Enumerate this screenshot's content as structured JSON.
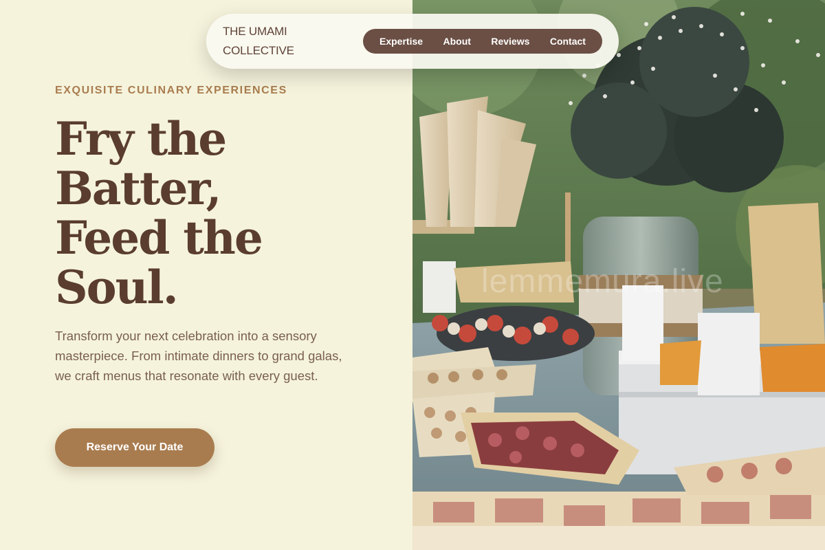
{
  "nav": {
    "brand_line1": "THE UMAMI",
    "brand_line2": "COLLECTIVE",
    "links": [
      "Expertise",
      "About",
      "Reviews",
      "Contact"
    ]
  },
  "hero": {
    "eyebrow": "EXQUISITE CULINARY EXPERIENCES",
    "headline_lines": [
      "Fry the",
      "Batter,",
      "Feed the",
      "Soul."
    ],
    "lede": "Transform your next celebration into a sensory masterpiece. From intimate dinners to grand galas, we craft menus that resonate with every guest.",
    "cta_label": "Reserve Your Date"
  },
  "image": {
    "watermark": "lemmemura.live"
  },
  "colors": {
    "background": "#f5f3dc",
    "accent": "#a97c4f",
    "brand_brown": "#5a3d2f",
    "nav_pill": "#6b4f44"
  }
}
